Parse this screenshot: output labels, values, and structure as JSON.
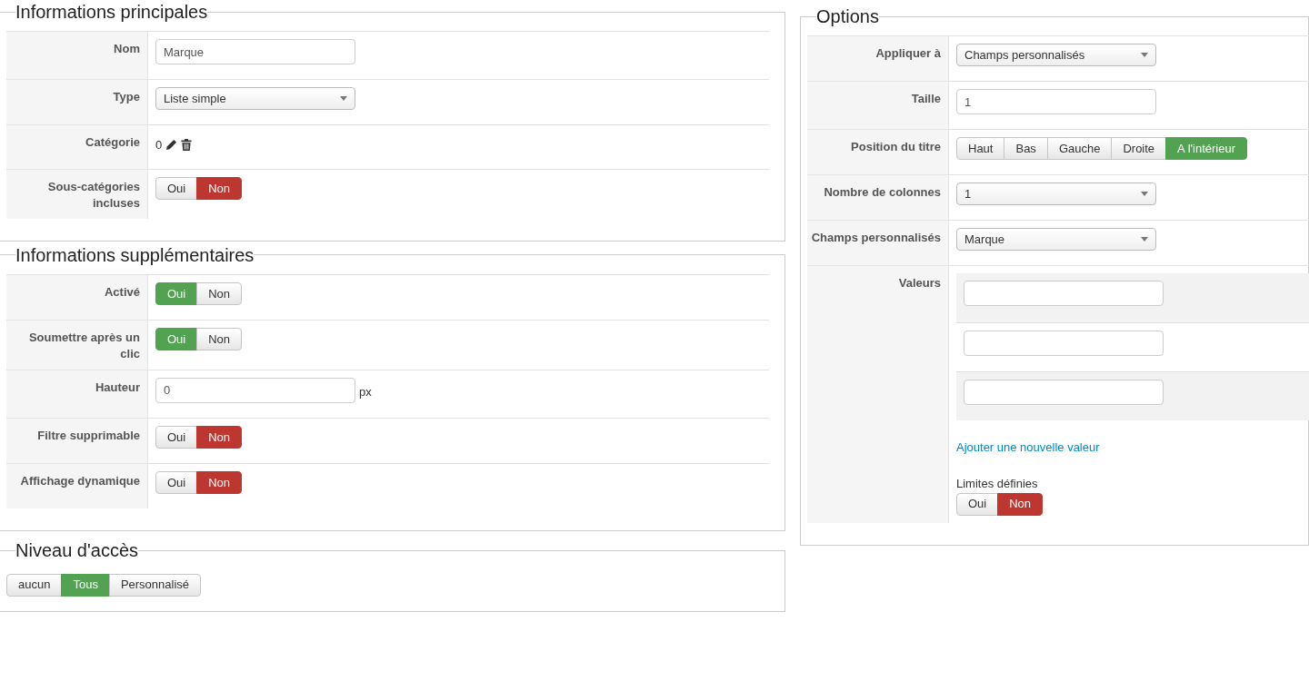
{
  "columns": [
    {
      "fieldsets": [
        {
          "legend": "Informations principales",
          "rows": [
            {
              "label": "Nom",
              "kind": "text",
              "value": "Marque"
            },
            {
              "label": "Type",
              "kind": "select",
              "value": "Liste simple"
            },
            {
              "label": "Catégorie",
              "kind": "category",
              "value": "0"
            },
            {
              "label": "Sous-catégories incluses",
              "kind": "toggle",
              "color": "#bd362f",
              "options": [
                {
                  "label": "Oui",
                  "selected": false
                },
                {
                  "label": "Non",
                  "selected": true
                }
              ]
            }
          ]
        },
        {
          "legend": "Informations supplémentaires",
          "rows": [
            {
              "label": "Activé",
              "kind": "toggle",
              "color": "#51a351",
              "options": [
                {
                  "label": "Oui",
                  "selected": true
                },
                {
                  "label": "Non",
                  "selected": false
                }
              ]
            },
            {
              "label": "Soumettre après un clic",
              "kind": "toggle",
              "color": "#51a351",
              "options": [
                {
                  "label": "Oui",
                  "selected": true
                },
                {
                  "label": "Non",
                  "selected": false
                }
              ]
            },
            {
              "label": "Hauteur",
              "kind": "text",
              "value": "0",
              "suffix": "px"
            },
            {
              "label": "Filtre supprimable",
              "kind": "toggle",
              "color": "#bd362f",
              "options": [
                {
                  "label": "Oui",
                  "selected": false
                },
                {
                  "label": "Non",
                  "selected": true
                }
              ]
            },
            {
              "label": "Affichage dynamique",
              "kind": "toggle",
              "color": "#bd362f",
              "options": [
                {
                  "label": "Oui",
                  "selected": false
                },
                {
                  "label": "Non",
                  "selected": true
                }
              ]
            }
          ]
        },
        {
          "legend": "Niveau d'accès",
          "color": "#51a351",
          "options": [
            {
              "label": "aucun",
              "selected": false
            },
            {
              "label": "Tous",
              "selected": true
            },
            {
              "label": "Personnalisé",
              "selected": false
            }
          ]
        }
      ]
    },
    {
      "fieldsets": [
        {
          "legend": "Options",
          "rows": [
            {
              "label": "Appliquer à",
              "kind": "select",
              "value": "Champs personnalisés"
            },
            {
              "label": "Taille",
              "kind": "text",
              "value": "1"
            },
            {
              "label": "Position du titre",
              "kind": "toggle",
              "color": "#51a351",
              "options": [
                {
                  "label": "Haut",
                  "selected": false
                },
                {
                  "label": "Bas",
                  "selected": false
                },
                {
                  "label": "Gauche",
                  "selected": false
                },
                {
                  "label": "Droite",
                  "selected": false
                },
                {
                  "label": "A l'intérieur",
                  "selected": true
                }
              ]
            },
            {
              "label": "Nombre de colonnes",
              "kind": "select",
              "value": "1"
            },
            {
              "label": "Champs personnalisés",
              "kind": "select",
              "value": "Marque"
            },
            {
              "label": "Valeurs",
              "kind": "values",
              "fields": [
                {
                  "striped": true
                },
                {
                  "striped": false
                },
                {
                  "striped": true
                }
              ],
              "link": "Ajouter une nouvelle valeur",
              "sublabel": "Limites définies",
              "color": "#bd362f",
              "options": [
                {
                  "label": "Oui",
                  "selected": false
                },
                {
                  "label": "Non",
                  "selected": true
                }
              ]
            }
          ]
        }
      ]
    }
  ]
}
